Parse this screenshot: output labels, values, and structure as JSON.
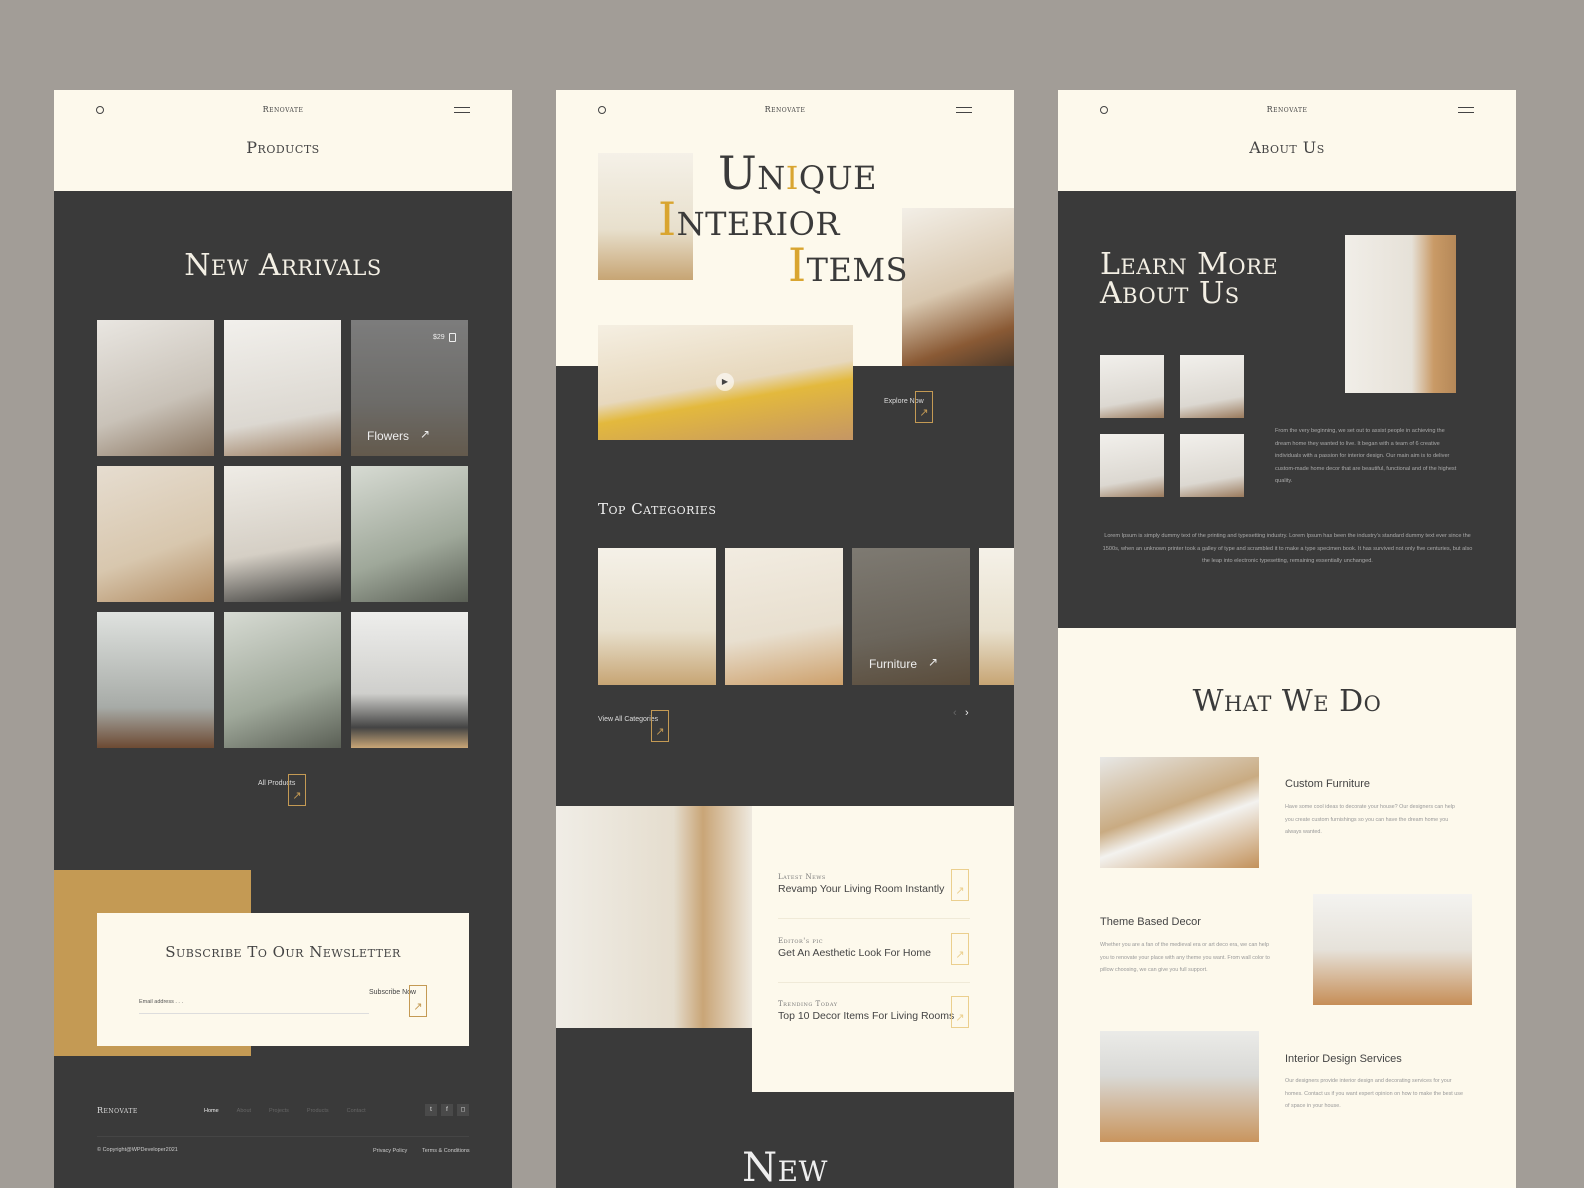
{
  "brand": "Renovate",
  "colors": {
    "background": "#a29d97",
    "cream": "#fdf9ec",
    "dark": "#3a3a3a",
    "gold": "#c49a54",
    "accent": "#d9a530"
  },
  "products_page": {
    "title": "Products",
    "section_title": "New Arrivals",
    "featured": {
      "price": "$29",
      "label": "Flowers"
    },
    "all_products": "All Products",
    "newsletter": {
      "title": "Subscribe To Our Newsletter",
      "email_placeholder": "Email address . . .",
      "button": "Subscribe Now"
    },
    "footer": {
      "logo": "Renovate",
      "nav": [
        "Home",
        "About",
        "Projects",
        "Products",
        "Contact"
      ],
      "social": [
        "twitter-icon",
        "facebook-icon",
        "instagram-icon"
      ],
      "copyright": "© Copyright@WPDeveloper2021",
      "links": [
        "Privacy Policy",
        "Terms & Conditions"
      ]
    }
  },
  "home_page": {
    "hero": {
      "line1": "Unique",
      "line2": "Interior",
      "line3": "Items"
    },
    "explore": "Explore Now",
    "categories_title": "Top Categories",
    "featured_category": "Furniture",
    "view_all": "View All Categories",
    "news": [
      {
        "label": "Latest News",
        "title": "Revamp Your Living Room Instantly"
      },
      {
        "label": "Editor's pic",
        "title": "Get An Aesthetic Look For Home"
      },
      {
        "label": "Trending Today",
        "title": "Top 10 Decor Items For Living Rooms"
      }
    ],
    "bottom_heading": "New"
  },
  "about_page": {
    "title": "About Us",
    "heading_line1": "Learn More",
    "heading_line2": "About Us",
    "intro": "From the very beginning, we set out to assist people in achieving the dream home they wanted to live. It began with a team of 6 creative individuals with a passion for interior design. Our main aim is to deliver custom-made home decor that are beautiful, functional and of the highest quality.",
    "lorem": "Lorem Ipsum is simply dummy text of the printing and typesetting industry. Lorem Ipsum has been the industry's standard dummy text ever since the 1500s, when an unknown printer took a galley of type and scrambled it to make a type specimen book. It has survived not only five centuries, but also the leap into electronic typesetting, remaining essentially unchanged.",
    "what_we_do_title": "What We Do",
    "services": [
      {
        "title": "Custom Furniture",
        "text": "Have some cool ideas to decorate your house? Our designers can help you create custom furnishings so you can have the dream home you always wanted."
      },
      {
        "title": "Theme Based Decor",
        "text": "Whether you are a fan of the medieval era or art deco era, we can help you to renovate your place with any theme you want. From wall color to pillow choosing, we can give you full support."
      },
      {
        "title": "Interior Design Services",
        "text": "Our designers provide interior design and decorating services for your homes. Contact us if you want expert opinion on how to make the best use of space in your house."
      }
    ]
  }
}
